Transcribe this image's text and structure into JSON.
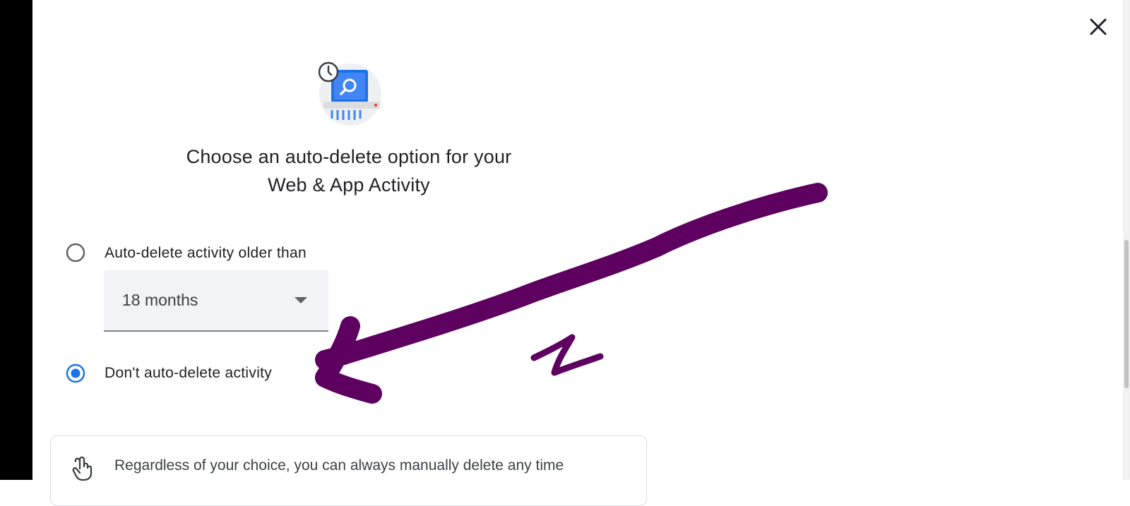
{
  "dialog": {
    "title_line1": "Choose an auto-delete option for your",
    "title_line2": "Web & App Activity"
  },
  "options": [
    {
      "label": "Auto-delete activity older than",
      "selected": false
    },
    {
      "label": "Don't auto-delete activity",
      "selected": true
    }
  ],
  "auto_delete_select": {
    "value": "18 months"
  },
  "info": {
    "text": "Regardless of your choice, you can always manually delete any time"
  },
  "icons": {
    "close": "close-icon",
    "hero": "activity-shredder-icon",
    "info": "hand-touch-icon"
  },
  "colors": {
    "accent": "#1a73e8",
    "annotation": "#5e0060"
  }
}
